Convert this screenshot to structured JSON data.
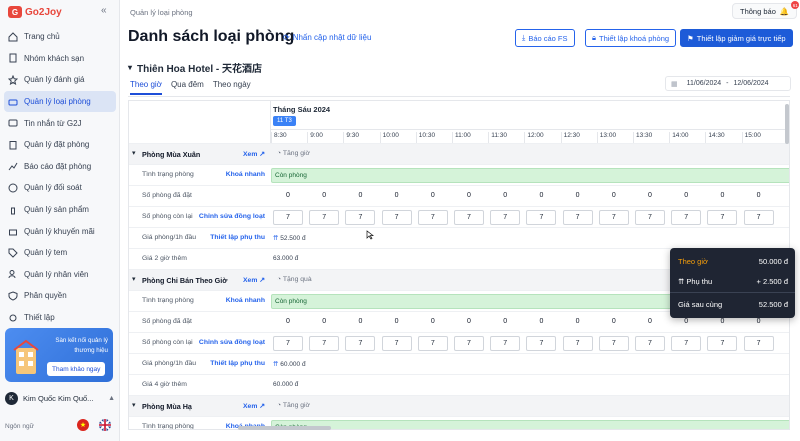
{
  "app": {
    "logo_text": "Go2Joy",
    "logo_mark": "G"
  },
  "sidebar": {
    "items": [
      {
        "label": "Trang chủ",
        "icon": "home-icon",
        "active": false
      },
      {
        "label": "Nhóm khách sạn",
        "icon": "building-icon",
        "active": false
      },
      {
        "label": "Quản lý đánh giá",
        "icon": "star-icon",
        "active": false
      },
      {
        "label": "Quản lý loại phòng",
        "icon": "room-icon",
        "active": true
      },
      {
        "label": "Tin nhắn từ G2J",
        "icon": "message-icon",
        "active": false
      },
      {
        "label": "Quản lý đặt phòng",
        "icon": "clipboard-icon",
        "active": false
      },
      {
        "label": "Báo cáo đặt phòng",
        "icon": "chart-icon",
        "active": false
      },
      {
        "label": "Quản lý đối soát",
        "icon": "money-icon",
        "active": false
      },
      {
        "label": "Quản lý sản phẩm",
        "icon": "bottle-icon",
        "active": false
      },
      {
        "label": "Quản lý khuyến mãi",
        "icon": "gift-icon",
        "active": false
      },
      {
        "label": "Quản lý tem",
        "icon": "tag-icon",
        "active": false
      },
      {
        "label": "Quản lý nhân viên",
        "icon": "users-icon",
        "active": false
      },
      {
        "label": "Phân quyền",
        "icon": "shield-icon",
        "active": false
      },
      {
        "label": "Thiết lập",
        "icon": "settings-icon",
        "active": false
      }
    ],
    "promo": {
      "text": "Sàn kết nối quản lý thương hiệu",
      "button": "Tham khảo ngay"
    },
    "user": {
      "initial": "K",
      "name": "Kim Quốc Kim Quố..."
    },
    "language_label": "Ngôn ngữ"
  },
  "header": {
    "breadcrumb": "Quản lý loại phòng",
    "notification_label": "Thông báo",
    "notification_count": "61"
  },
  "page": {
    "title": "Danh sách loại phòng",
    "refresh_label": "Nhấn cập nhật dữ liệu",
    "buttons": {
      "report": "Báo cáo FS",
      "lock": "Thiết lập khoá phòng",
      "discount": "Thiết lập giảm giá trực tiếp"
    },
    "hotel_name": "Thiên Hoa Hotel - 天花酒店",
    "tabs": [
      "Theo giờ",
      "Qua đêm",
      "Theo ngày"
    ],
    "active_tab": "Theo giờ",
    "date_from": "11/06/2024",
    "date_sep": "-",
    "date_to": "12/06/2024"
  },
  "grid": {
    "month": "Tháng Sáu 2024",
    "day": "11 T3",
    "times": [
      "8:30",
      "9:00",
      "9:30",
      "10:00",
      "10:30",
      "11:00",
      "11:30",
      "12:00",
      "12:30",
      "13:00",
      "13:30",
      "14:00",
      "14:30",
      "15:00"
    ],
    "labels": {
      "status": "Tình trạng phòng",
      "booked": "Số phòng đã đặt",
      "remaining": "Số phòng còn lại",
      "first_hour": "Giá phòng/1h đầu",
      "extra_2": "Giá 2 giờ thêm",
      "extra_4": "Giá 4 giờ thêm",
      "quick_lock": "Khoá nhanh",
      "bulk_edit": "Chỉnh sửa đồng loạt",
      "surcharge": "Thiết lập phụ thu",
      "view": "Xem",
      "available": "Còn phòng"
    },
    "groups": [
      {
        "name": "Phòng Mùa Xuân",
        "tag": "Tăng giờ",
        "booked": "0",
        "remaining": "7",
        "first_hour": "52.500 đ",
        "extra_label": "Giá 2 giờ thêm",
        "extra": "63.000 đ"
      },
      {
        "name": "Phòng Chỉ Bán Theo Giờ",
        "tag": "Tặng quà",
        "booked": "0",
        "remaining": "7",
        "first_hour": "60.000 đ",
        "extra_label": "Giá 4 giờ thêm",
        "extra": "60.000 đ"
      },
      {
        "name": "Phòng Mùa Hạ",
        "tag": "Tăng giờ"
      }
    ]
  },
  "tooltip": {
    "by_hour_label": "Theo giờ",
    "by_hour_value": "50.000 đ",
    "surcharge_label": "Phụ thu",
    "surcharge_value": "+ 2.500 đ",
    "final_label": "Giá sau cùng",
    "final_value": "52.500 đ"
  },
  "colors": {
    "primary": "#1d5bd8",
    "brand": "#e8473c",
    "available_bg": "#d5f3d9",
    "tooltip_bg": "#1f2533",
    "tooltip_accent": "#f59e0b"
  }
}
